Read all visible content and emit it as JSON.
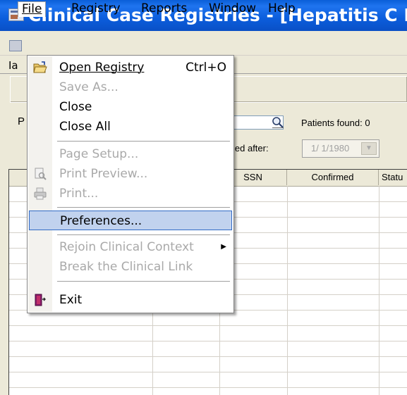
{
  "window": {
    "title": "Clinical Case Registries - [Hepatitis C R"
  },
  "menubar": {
    "items": [
      {
        "label": "File"
      },
      {
        "label": "Registry"
      },
      {
        "label": "Reports"
      },
      {
        "label": "Window"
      },
      {
        "label": "Help"
      }
    ]
  },
  "tab_partial": "Ia",
  "search": {
    "label_partial": "P",
    "value": "",
    "patients_found": "Patients found: 0",
    "confirmed_after_label": "nfirmed after:",
    "confirmed_after_value": "1/ 1/1980"
  },
  "grid": {
    "columns": [
      "",
      "",
      "SSN",
      "Confirmed",
      "Statu"
    ]
  },
  "file_menu": {
    "items": [
      {
        "label": "Open Registry",
        "shortcut": "Ctrl+O",
        "enabled": true,
        "icon": "open-folder-icon"
      },
      {
        "label": "Save As...",
        "enabled": false
      },
      {
        "label": "Close",
        "enabled": true
      },
      {
        "label": "Close All",
        "enabled": true
      },
      {
        "label": "Page Setup...",
        "enabled": false
      },
      {
        "label": "Print Preview...",
        "enabled": false,
        "icon": "print-preview-icon"
      },
      {
        "label": "Print...",
        "enabled": false,
        "icon": "printer-icon"
      },
      {
        "label": "Preferences...",
        "enabled": true,
        "highlighted": true
      },
      {
        "label": "Rejoin Clinical Context",
        "enabled": false,
        "submenu": true
      },
      {
        "label": "Break the Clinical Link",
        "enabled": false
      },
      {
        "label": "Exit",
        "enabled": true,
        "icon": "exit-door-icon"
      }
    ]
  },
  "colors": {
    "titlebar": "#0a5fd8",
    "highlight_fill": "#c1d2ee",
    "highlight_border": "#316ac5",
    "disabled_text": "#a9a9a9"
  }
}
